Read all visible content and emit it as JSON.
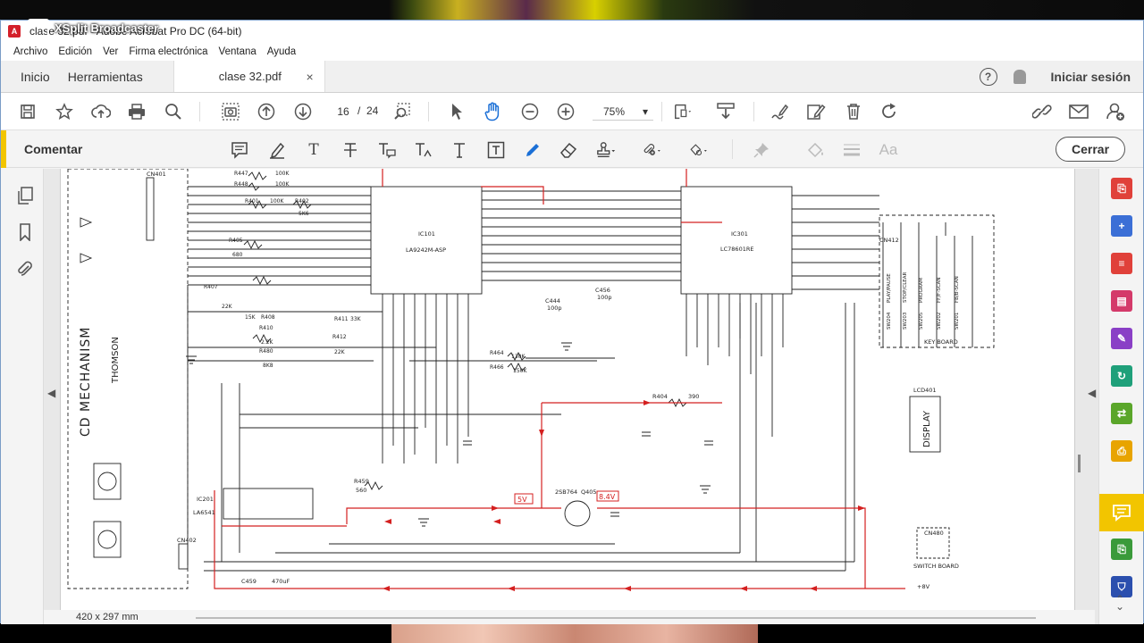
{
  "watermark": {
    "text": "XSplit Broadcaster"
  },
  "window": {
    "title": "clase 32.pdf - Adobe Acrobat Pro DC (64-bit)"
  },
  "menu": [
    "Archivo",
    "Edición",
    "Ver",
    "Firma electrónica",
    "Ventana",
    "Ayuda"
  ],
  "tabs": {
    "home": "Inicio",
    "tools": "Herramientas",
    "document": "clase 32.pdf",
    "close": "×",
    "help": "?",
    "signin": "Iniciar sesión"
  },
  "toolbar": {
    "page_current": "16",
    "page_sep": "/",
    "page_total": "24",
    "zoom": "75%",
    "dropdown": "▾"
  },
  "commentbar": {
    "label": "Comentar",
    "close_label": "Cerrar",
    "text_tool": "T",
    "aa": "Aa"
  },
  "status": {
    "page_size": "420 x 297 mm"
  },
  "schematic": {
    "labels": {
      "cd_mechanism": "CD MECHANISM",
      "thomson": "THOMSON",
      "ic101": "IC101",
      "ic101_part": "LA9242M-ASP",
      "ic301": "IC301",
      "ic301_part": "LC78601RE",
      "ic201": "IC201",
      "ic201_part": "LA6541",
      "key_board": "KEY BOARD",
      "lcd401": "LCD401",
      "display": "DISPLAY",
      "switch_board": "SWITCH BOARD",
      "cn480": "CN480",
      "cn412": "CN412",
      "cn402": "CN402",
      "cn401": "CN401",
      "q405": "Q405",
      "q405_part": "2SB764",
      "v5": "5V",
      "v84": "8.4V",
      "plus8v": "+8V",
      "r404": "R404",
      "r404_val": "390",
      "c459": "C459",
      "c459_val": "470uF",
      "r459": "R459",
      "r459_val": "560",
      "c444": "C444",
      "c444_val": "100p",
      "c456": "C456",
      "c456_val": "100p"
    },
    "keys": [
      "PLAY/PAUSE",
      "STOP/CLEAR",
      "PROGRAM",
      "FF/F-SCAN",
      "FB/B-SCAN"
    ],
    "switches": [
      "SW204",
      "SW203",
      "SW205",
      "SW202",
      "SW201"
    ],
    "resistors_left": [
      {
        "name": "R447",
        "val": "100K"
      },
      {
        "name": "R448",
        "val": "100K"
      },
      {
        "name": "R401",
        "val": "100K"
      },
      {
        "name": "R402",
        "val": "5K6"
      },
      {
        "name": "R405",
        "val": "680"
      },
      {
        "name": "R407",
        "val": "22K"
      },
      {
        "name": "R408",
        "val": "15K"
      },
      {
        "name": "R410",
        "val": "2.2K"
      },
      {
        "name": "R480",
        "val": "8K8"
      },
      {
        "name": "R411",
        "val": "33K"
      },
      {
        "name": "R412",
        "val": "22K"
      },
      {
        "name": "R464",
        "val": "130K"
      },
      {
        "name": "R466",
        "val": "150K"
      }
    ]
  }
}
